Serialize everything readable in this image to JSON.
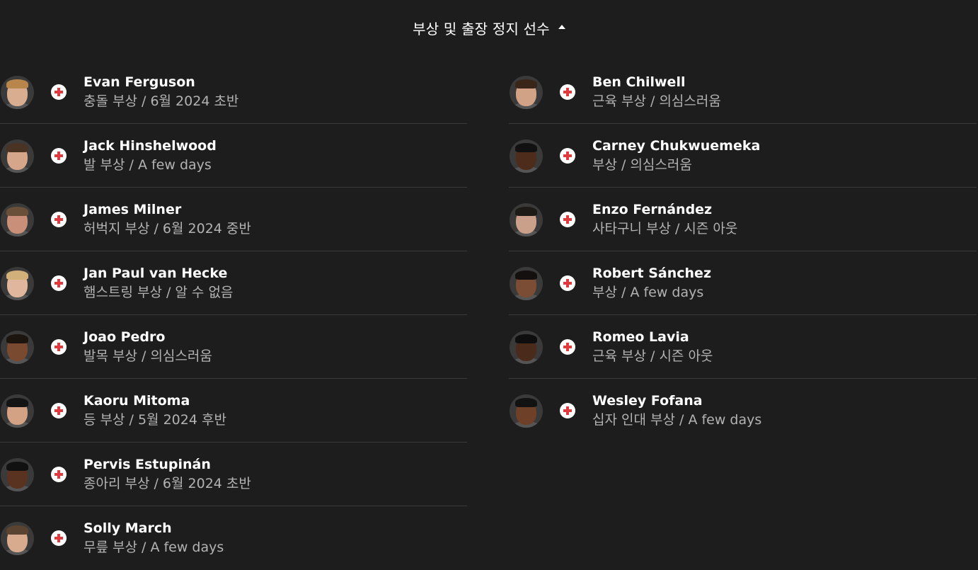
{
  "header": {
    "title": "부상 및 출장 정지 선수",
    "toggle_icon": "caret-up-icon"
  },
  "colors": {
    "background": "#1d1d1d",
    "divider": "#3a3a3a",
    "status_text": "#b3b3b3",
    "injury_cross": "#e0393e"
  },
  "left_players": [
    {
      "name": "Evan Ferguson",
      "status": "충돌 부상 / 6월 2024 초반",
      "icon": "injury-cross-icon"
    },
    {
      "name": "Jack Hinshelwood",
      "status": "발 부상 / A few days",
      "icon": "injury-cross-icon"
    },
    {
      "name": "James Milner",
      "status": "허벅지 부상 / 6월 2024 중반",
      "icon": "injury-cross-icon"
    },
    {
      "name": "Jan Paul van Hecke",
      "status": "햄스트링 부상 / 알 수 없음",
      "icon": "injury-cross-icon"
    },
    {
      "name": "Joao Pedro",
      "status": "발목 부상 / 의심스러움",
      "icon": "injury-cross-icon"
    },
    {
      "name": "Kaoru Mitoma",
      "status": "등 부상 / 5월 2024 후반",
      "icon": "injury-cross-icon"
    },
    {
      "name": "Pervis Estupinán",
      "status": "종아리 부상 / 6월 2024 초반",
      "icon": "injury-cross-icon"
    },
    {
      "name": "Solly March",
      "status": "무릎 부상 / A few days",
      "icon": "injury-cross-icon"
    }
  ],
  "right_players": [
    {
      "name": "Ben Chilwell",
      "status": "근육 부상 / 의심스러움",
      "icon": "injury-cross-icon"
    },
    {
      "name": "Carney Chukwuemeka",
      "status": "부상 / 의심스러움",
      "icon": "injury-cross-icon"
    },
    {
      "name": "Enzo Fernández",
      "status": "사타구니 부상 / 시즌 아웃",
      "icon": "injury-cross-icon"
    },
    {
      "name": "Robert Sánchez",
      "status": "부상 / A few days",
      "icon": "injury-cross-icon"
    },
    {
      "name": "Romeo Lavia",
      "status": "근육 부상 / 시즌 아웃",
      "icon": "injury-cross-icon"
    },
    {
      "name": "Wesley Fofana",
      "status": "십자 인대 부상 / A few days",
      "icon": "injury-cross-icon"
    }
  ]
}
